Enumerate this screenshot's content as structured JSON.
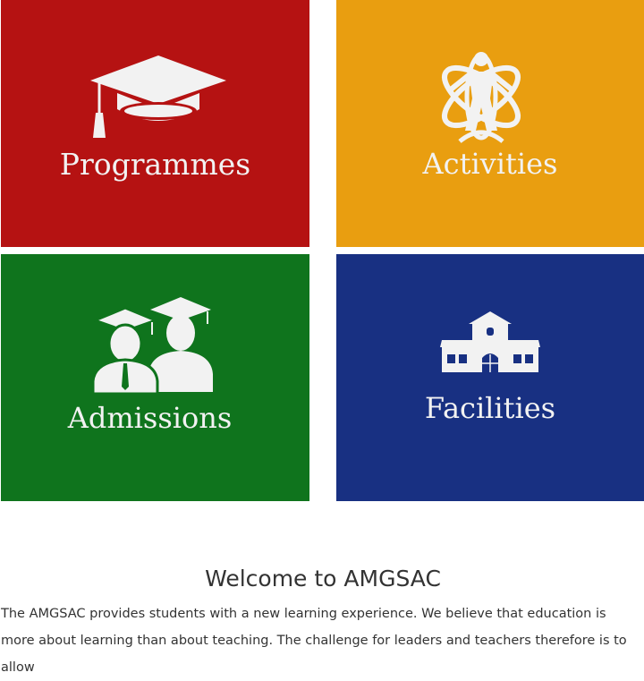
{
  "tiles": [
    {
      "label": "Programmes",
      "color": "#b51212",
      "icon": "graduation-cap-icon"
    },
    {
      "label": "Activities",
      "color": "#e99e10",
      "icon": "activities-emblem-icon"
    },
    {
      "label": "Admissions",
      "color": "#0f741d",
      "icon": "graduates-icon"
    },
    {
      "label": "Facilities",
      "color": "#183082",
      "icon": "school-building-icon"
    }
  ],
  "welcome": {
    "title": "Welcome to AMGSAC",
    "text": "The AMGSAC provides students with a new learning experience. We believe that education is more about learning than about teaching. The challenge for leaders and teachers therefore is to allow"
  }
}
